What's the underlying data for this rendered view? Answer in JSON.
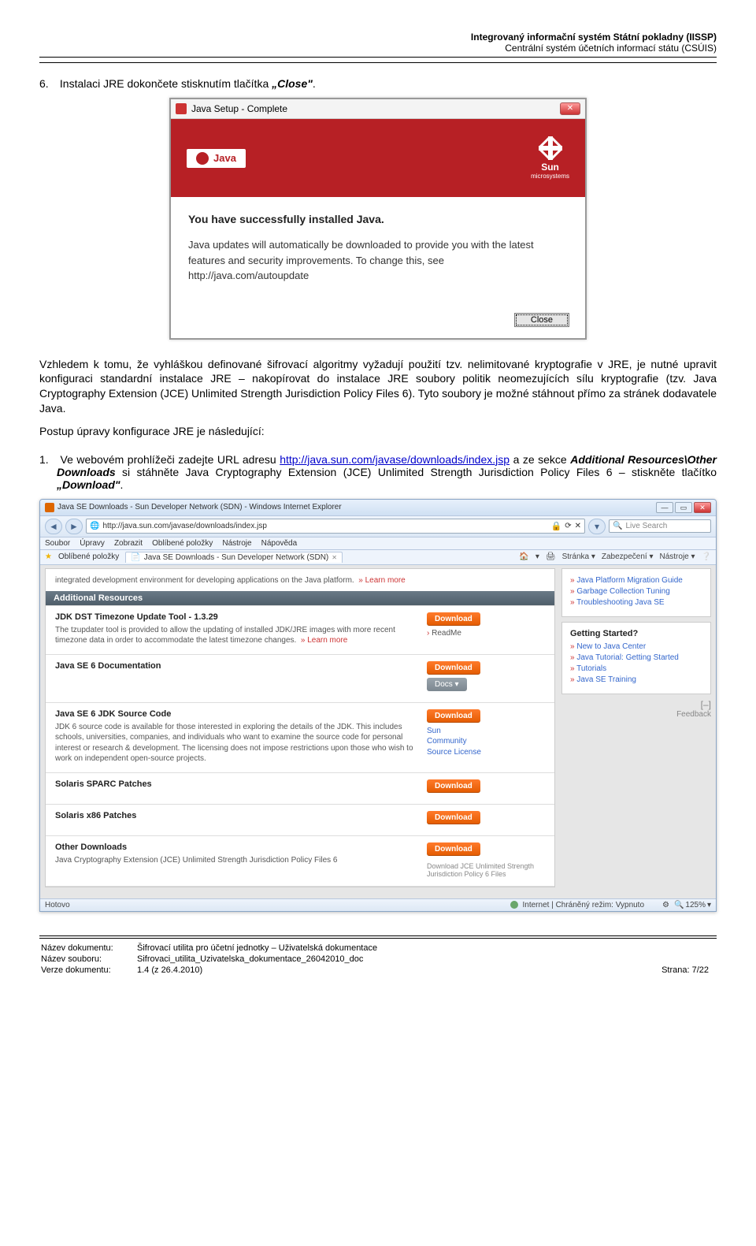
{
  "header": {
    "line1": "Integrovaný informační systém Státní pokladny (IISSP)",
    "line2": "Centrální systém účetních informací státu (CSÚIS)"
  },
  "step6": {
    "num": "6.",
    "text_prefix": "Instalaci JRE dokončete stisknutím tlačítka ",
    "close_q": "„Close\"",
    "tail": "."
  },
  "java_dialog": {
    "title": "Java Setup - Complete",
    "brand": "Java",
    "vendor_top": "Sun",
    "vendor_sub": "microsystems",
    "heading": "You have successfully installed Java.",
    "para1a": "Java updates will automatically be downloaded to provide you with the latest features and security improvements. To change this, see",
    "para1b": "http://java.com/autoupdate",
    "btn": "Close"
  },
  "para1": "Vzhledem k tomu, že vyhláškou definované šifrovací algoritmy vyžadují použití tzv. nelimitované kryptografie v JRE, je nutné upravit konfiguraci standardní instalace JRE – nakopírovat do instalace JRE soubory politik neomezujících sílu kryptografie (tzv. Java Cryptography Extension (JCE) Unlimited Strength Jurisdiction Policy Files 6). Tyto soubory je možné stáhnout přímo za stránek dodavatele Java.",
  "para2": "Postup úpravy konfigurace JRE je následující:",
  "step1": {
    "num": "1.",
    "a": "Ve webovém prohlížeči zadejte URL adresu ",
    "link_text": "http://java.sun.com/javase/downloads/index.jsp",
    "b": " a ze sekce ",
    "c": "Additional Resources\\Other Downloads",
    "d": " si stáhněte Java Cryptography Extension (JCE) Unlimited Strength Jurisdiction Policy Files 6 – stiskněte tlačítko ",
    "e": "„Download\"",
    "f": "."
  },
  "ie": {
    "title": "Java SE Downloads - Sun Developer Network (SDN) - Windows Internet Explorer",
    "url": "http://java.sun.com/javase/downloads/index.jsp",
    "search_ph": "Live Search",
    "menu": [
      "Soubor",
      "Úpravy",
      "Zobrazit",
      "Oblíbené položky",
      "Nástroje",
      "Nápověda"
    ],
    "fav_label": "Oblíbené položky",
    "tab": "Java SE Downloads - Sun Developer Network (SDN)",
    "tools": [
      "Stránka ▾",
      "Zabezpečení ▾",
      "Nástroje ▾"
    ],
    "intro": "integrated development environment for developing applications on the Java platform.",
    "learn_more": "» Learn more",
    "section": "Additional Resources",
    "pkg_tz_title": "JDK DST Timezone Update Tool - 1.3.29",
    "pkg_tz_desc": "The tzupdater tool is provided to allow the updating of installed JDK/JRE images with more recent timezone data in order to accommodate the latest timezone changes.",
    "readme": "ReadMe",
    "pkg_doc_title": "Java SE 6 Documentation",
    "docs_btn": "Docs ▾",
    "pkg_src_title": "Java SE 6 JDK Source Code",
    "pkg_src_desc": "JDK 6 source code is available for those interested in exploring the details of the JDK. This includes schools, universities, companies, and individuals who want to examine the source code for personal interest or research & development. The licensing does not impose restrictions upon those who wish to work on independent open-source projects.",
    "src_links": [
      "Sun",
      "Community",
      "Source License"
    ],
    "pkg_sparc": "Solaris SPARC Patches",
    "pkg_x86": "Solaris x86 Patches",
    "pkg_other": "Other Downloads",
    "pkg_other_desc": "Java Cryptography Extension (JCE) Unlimited Strength Jurisdiction Policy Files 6",
    "pkg_other_sub": "Download JCE Unlimited Strength Jurisdiction Policy 6 Files",
    "download": "Download",
    "aside1_title": "",
    "aside1_items": [
      "Java Platform Migration Guide",
      "Garbage Collection Tuning",
      "Troubleshooting Java SE"
    ],
    "aside2_title": "Getting Started?",
    "aside2_items": [
      "New to Java Center",
      "Java Tutorial: Getting Started",
      "Tutorials",
      "Java SE Training"
    ],
    "feedback": "Feedback",
    "status_left": "Hotovo",
    "status_mid": "Internet | Chráněný režim: Vypnuto",
    "zoom": "125%"
  },
  "footer": {
    "l1": "Název dokumentu:",
    "v1": "Šifrovací utilita pro účetní jednotky – Uživatelská dokumentace",
    "l2": "Název souboru:",
    "v2": "Sifrovaci_utilita_Uzivatelska_dokumentace_26042010_doc",
    "l3": "Verze dokumentu:",
    "v3": "1.4 (z 26.4.2010)",
    "page": "Strana: 7/22"
  }
}
